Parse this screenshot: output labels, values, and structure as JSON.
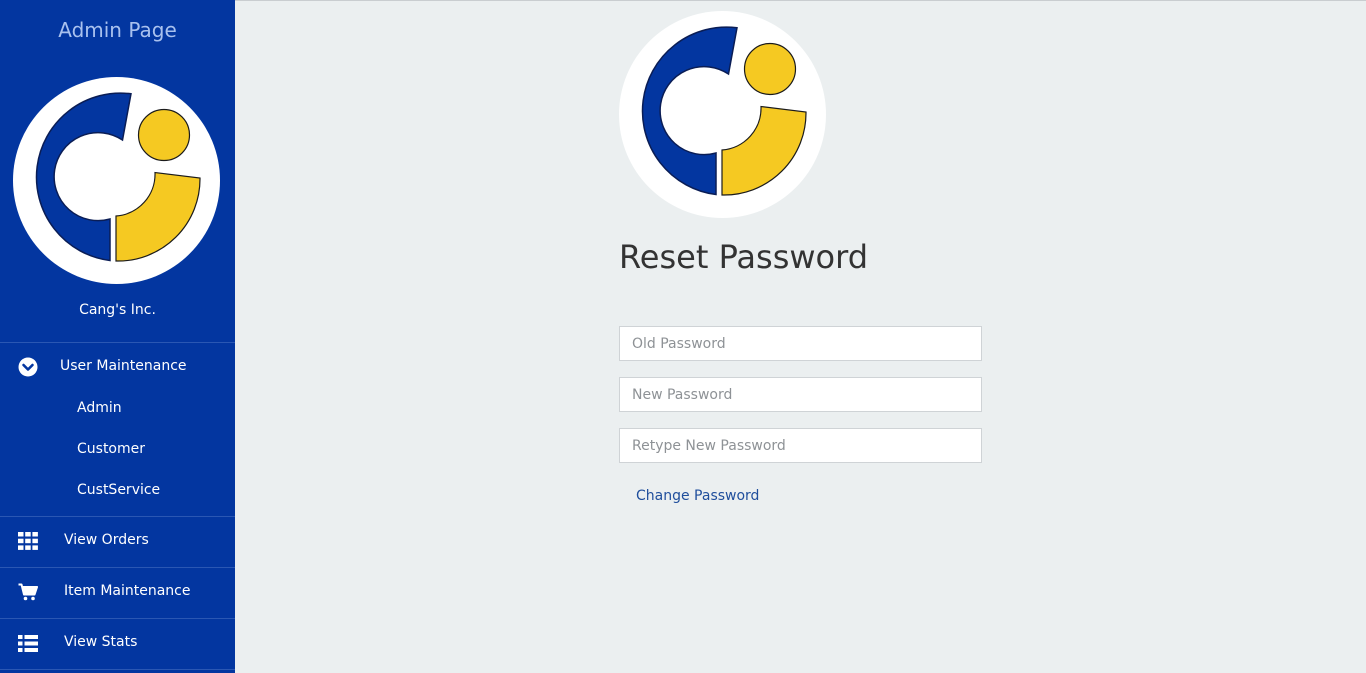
{
  "sidebar": {
    "title": "Admin Page",
    "company": "Cang's Inc.",
    "user_maintenance": {
      "label": "User Maintenance",
      "icon": "chevron-circle-down-icon",
      "children": [
        "Admin",
        "Customer",
        "CustService"
      ]
    },
    "view_orders": {
      "label": "View Orders",
      "icon": "grid-icon"
    },
    "item_maintenance": {
      "label": "Item Maintenance",
      "icon": "cart-icon"
    },
    "view_stats": {
      "label": "View Stats",
      "icon": "list-icon"
    }
  },
  "form": {
    "title": "Reset Password",
    "old_password_placeholder": "Old Password",
    "new_password_placeholder": "New Password",
    "retype_password_placeholder": "Retype New Password",
    "submit_label": "Change Password"
  },
  "colors": {
    "brand_blue": "#0336a0",
    "brand_yellow": "#f5c922",
    "background": "#ebeff0"
  }
}
